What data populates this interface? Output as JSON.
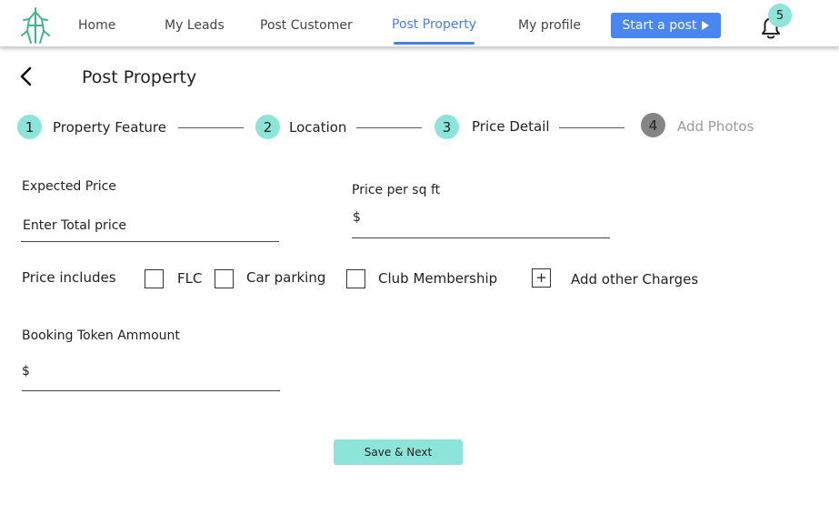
{
  "nav": {
    "home": "Home",
    "my_leads": "My Leads",
    "post_customer": "Post  Customer",
    "post_property": "Post Property",
    "my_profile": "My profile",
    "start_post": "Start a post",
    "notification_count": "5",
    "active": "Post Property"
  },
  "page": {
    "title": "Post Property"
  },
  "steps": [
    {
      "number": "1",
      "label": "Property Feature",
      "status": "done"
    },
    {
      "number": "2",
      "label": "Location",
      "status": "done"
    },
    {
      "number": "3",
      "label": "Price Detail",
      "status": "current"
    },
    {
      "number": "4",
      "label": "Add Photos",
      "status": "pending"
    }
  ],
  "form": {
    "expected_price": {
      "label": "Expected Price",
      "placeholder": "Enter Total price",
      "value": ""
    },
    "price_per_sqft": {
      "label": "Price per sq ft",
      "prefix": "$",
      "value": ""
    },
    "price_includes": {
      "label": "Price includes",
      "options": [
        {
          "label": "FLC",
          "checked": false
        },
        {
          "label": "Car parking",
          "checked": false
        },
        {
          "label": "Club Membership",
          "checked": false
        }
      ],
      "add_other": {
        "icon": "+",
        "label": "Add other Charges"
      }
    },
    "booking_token": {
      "label": "Booking Token Ammount",
      "prefix": "$",
      "value": ""
    }
  },
  "actions": {
    "save_next": "Save & Next"
  },
  "colors": {
    "accent": "#8ce5d8",
    "primary": "#4a86f0",
    "active_nav": "#4a7fe0",
    "inactive_step": "#858585"
  }
}
